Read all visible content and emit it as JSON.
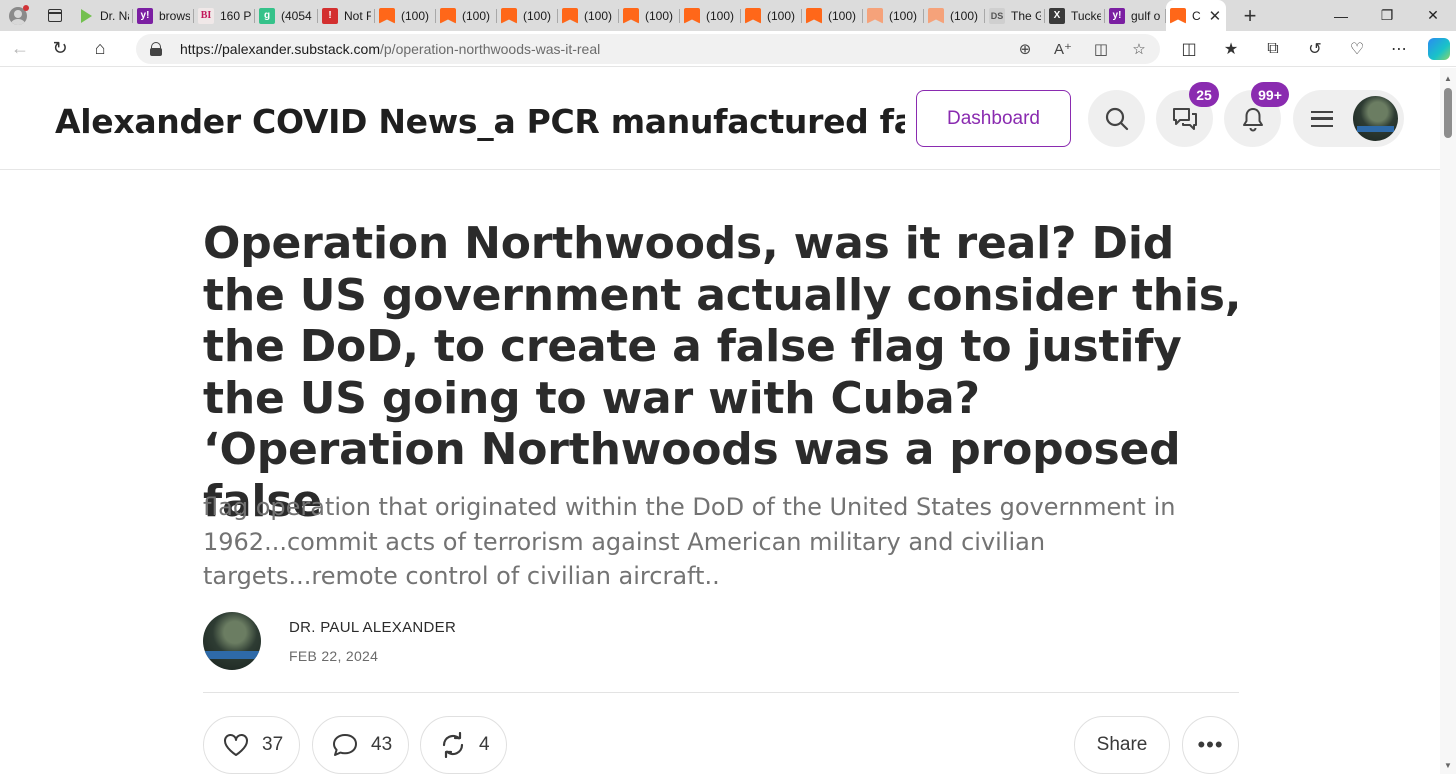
{
  "browser": {
    "tabs": [
      {
        "title": "Dr. Na",
        "favicon": "play-icon"
      },
      {
        "title": "brows",
        "favicon": "yahoo-icon"
      },
      {
        "title": "160 P",
        "favicon": "bi-icon"
      },
      {
        "title": "(4054",
        "favicon": "g-icon"
      },
      {
        "title": "Not F",
        "favicon": "red-icon"
      },
      {
        "title": "(100)",
        "favicon": "substack-icon"
      },
      {
        "title": "(100)",
        "favicon": "substack-icon"
      },
      {
        "title": "(100)",
        "favicon": "substack-icon"
      },
      {
        "title": "(100)",
        "favicon": "substack-icon"
      },
      {
        "title": "(100)",
        "favicon": "substack-icon"
      },
      {
        "title": "(100)",
        "favicon": "substack-icon"
      },
      {
        "title": "(100)",
        "favicon": "substack-icon"
      },
      {
        "title": "(100)",
        "favicon": "substack-icon"
      },
      {
        "title": "(100)",
        "favicon": "substack-icon"
      },
      {
        "title": "(100)",
        "favicon": "substack-icon"
      },
      {
        "title": "The G",
        "favicon": "ds-icon"
      },
      {
        "title": "Tucke",
        "favicon": "x-icon"
      },
      {
        "title": "gulf o",
        "favicon": "yahoo-icon"
      },
      {
        "title": "C",
        "favicon": "substack-icon",
        "active": true
      }
    ],
    "url_host": "https://palexander.substack.com",
    "url_path": "/p/operation-northwoods-was-it-real"
  },
  "site": {
    "publication_title": "Alexander COVID News_a PCR manufactured fake C...",
    "dashboard_label": "Dashboard",
    "chat_badge": "25",
    "notifications_badge": "99+",
    "brand_color": "#8a2bb0"
  },
  "article": {
    "headline": "Operation Northwoods, was it real? Did the US government actually consider this, the DoD, to create a false flag to justify the US going to war with Cuba? ‘Operation Northwoods was a proposed false",
    "subtitle": "flag operation that originated within the DoD of the United States government in 1962...commit acts of terrorism against American military and civilian targets...remote control of civilian aircraft..",
    "author": "DR. PAUL ALEXANDER",
    "date": "FEB 22, 2024",
    "likes": "37",
    "comments": "43",
    "restacks": "4",
    "share_label": "Share"
  }
}
